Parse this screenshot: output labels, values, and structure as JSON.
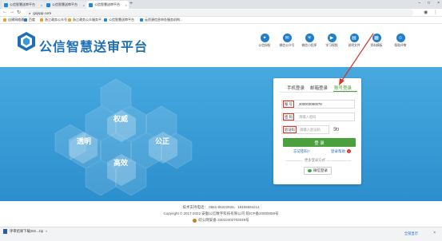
{
  "browser": {
    "tabs": [
      {
        "label": "公信智慧送审平台",
        "active": false
      },
      {
        "label": "公信智慧送审平台",
        "active": false
      },
      {
        "label": "公信智慧送审平台",
        "active": true
      }
    ],
    "new_tab": "+",
    "url": "gxjspp.com",
    "window_buttons": [
      "–",
      "□",
      "×"
    ],
    "bookmarks": [
      "自建网络通",
      "百度",
      "浙江政务公众号",
      "浙江政务公众服务平...",
      "公信智慧送审平台",
      "云资源信息申办服务机构..."
    ]
  },
  "header": {
    "logo_text": "公信智慧送审平台",
    "nav": [
      {
        "label": "公信授权",
        "icon": "certificate-icon",
        "glyph": "✦"
      },
      {
        "label": "微信公众号",
        "icon": "wechat-icon",
        "glyph": "✉"
      },
      {
        "label": "微信小程序",
        "icon": "miniprogram-icon",
        "glyph": "✳"
      },
      {
        "label": "学习视频",
        "icon": "video-icon",
        "glyph": "▶"
      },
      {
        "label": "说明文件",
        "icon": "document-icon",
        "glyph": "▤"
      },
      {
        "label": "资料模板",
        "icon": "template-icon",
        "glyph": "▦"
      },
      {
        "label": "帮助评审",
        "icon": "user-icon",
        "glyph": "☺"
      }
    ]
  },
  "banner": {
    "hex_words": [
      "权威",
      "透明",
      "公正",
      "高效"
    ]
  },
  "login": {
    "tabs": [
      "手机登录",
      "邮箱登录",
      "账号登录"
    ],
    "active_tab": "账号登录",
    "account_label": "账 号",
    "account_value": "200003090079",
    "password_label": "密 码",
    "password_placeholder": "请输入密码",
    "captcha_label": "验证码",
    "captcha_placeholder": "请输入验证码",
    "captcha_image_text": "9o",
    "login_button": "登 录",
    "forgot_link": "忘记密码?",
    "help_link": "登录帮助",
    "other_methods": "更多登录方式",
    "wechat_button": "微信登录",
    "accent_color": "#4aa03c"
  },
  "footer": {
    "support": "技术支持电话：  0551-65222826、18155694214",
    "copyright": "Copyright © 2017-2022  安徽公信数字科技有限公司  皖ICP备20000059号",
    "police": "皖公网安备 34010402702049号"
  },
  "downloads": {
    "file_name": "评审结果下载202...zip",
    "show_all": "全部显示",
    "close": "×"
  },
  "colors": {
    "brand_blue": "#1e6fb8",
    "banner_blue": "#3a9ad6",
    "annotation_red": "#d9342b"
  }
}
